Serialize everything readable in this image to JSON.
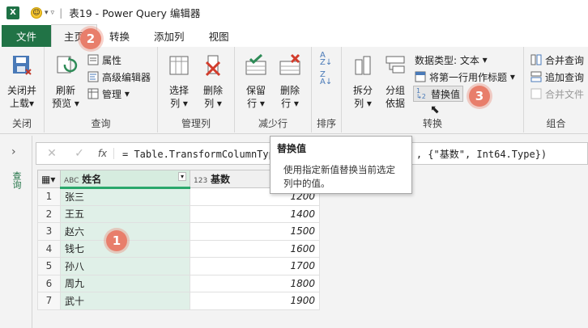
{
  "window": {
    "title": "表19 - Power Query 编辑器",
    "app_icon": "X",
    "toolbar_icons": [
      "smiley-icon",
      "customize-qat-icon"
    ]
  },
  "tabs": [
    {
      "label": "文件"
    },
    {
      "label": "主页"
    },
    {
      "label": "转换"
    },
    {
      "label": "添加列"
    },
    {
      "label": "视图"
    }
  ],
  "ribbon": {
    "close": {
      "btn1": "关闭并",
      "btn2": "上载",
      "arrow": "▾",
      "group": "关闭"
    },
    "query": {
      "refresh1": "刷新",
      "refresh2": "预览",
      "properties": "属性",
      "advanced": "高级编辑器",
      "manage": "管理",
      "group": "查询"
    },
    "cols": {
      "choose1": "选择",
      "choose2": "列",
      "remove1": "删除",
      "remove2": "列",
      "group": "管理列"
    },
    "rows": {
      "keep1": "保留",
      "keep2": "行",
      "remove1": "删除",
      "remove2": "行",
      "group": "减少行"
    },
    "sort": {
      "group": "排序"
    },
    "transform": {
      "split1": "拆分",
      "split2": "列",
      "groupby1": "分组",
      "groupby2": "依据",
      "datatype": "数据类型: 文本",
      "firstrow": "将第一行用作标题",
      "replace": "替换值",
      "group": "转换"
    },
    "combine": {
      "merge": "合并查询",
      "append": "追加查询",
      "mergefiles": "合并文件",
      "group": "组合"
    }
  },
  "formula": {
    "text": "= Table.TransformColumnTyp",
    "text2": ", {\"基数\", Int64.Type})",
    "fx": "fx"
  },
  "queries_label": "查询",
  "tooltip": {
    "title": "替换值",
    "desc1": "使用指定新值替换当前选定",
    "desc2": "列中的值。"
  },
  "table": {
    "columns": [
      {
        "type": "ABC",
        "name": "姓名"
      },
      {
        "type": "123",
        "name": "基数"
      }
    ],
    "rows": [
      {
        "n": "1",
        "name": "张三",
        "val": "1200"
      },
      {
        "n": "2",
        "name": "王五",
        "val": "1400"
      },
      {
        "n": "3",
        "name": "赵六",
        "val": "1500"
      },
      {
        "n": "4",
        "name": "钱七",
        "val": "1600"
      },
      {
        "n": "5",
        "name": "孙八",
        "val": "1700"
      },
      {
        "n": "6",
        "name": "周九",
        "val": "1800"
      },
      {
        "n": "7",
        "name": "武十",
        "val": "1900"
      }
    ]
  },
  "badges": [
    "1",
    "2",
    "3"
  ],
  "colors": {
    "accent": "#217346",
    "badge": "#e87e6b",
    "highlight": "#29a86b"
  }
}
